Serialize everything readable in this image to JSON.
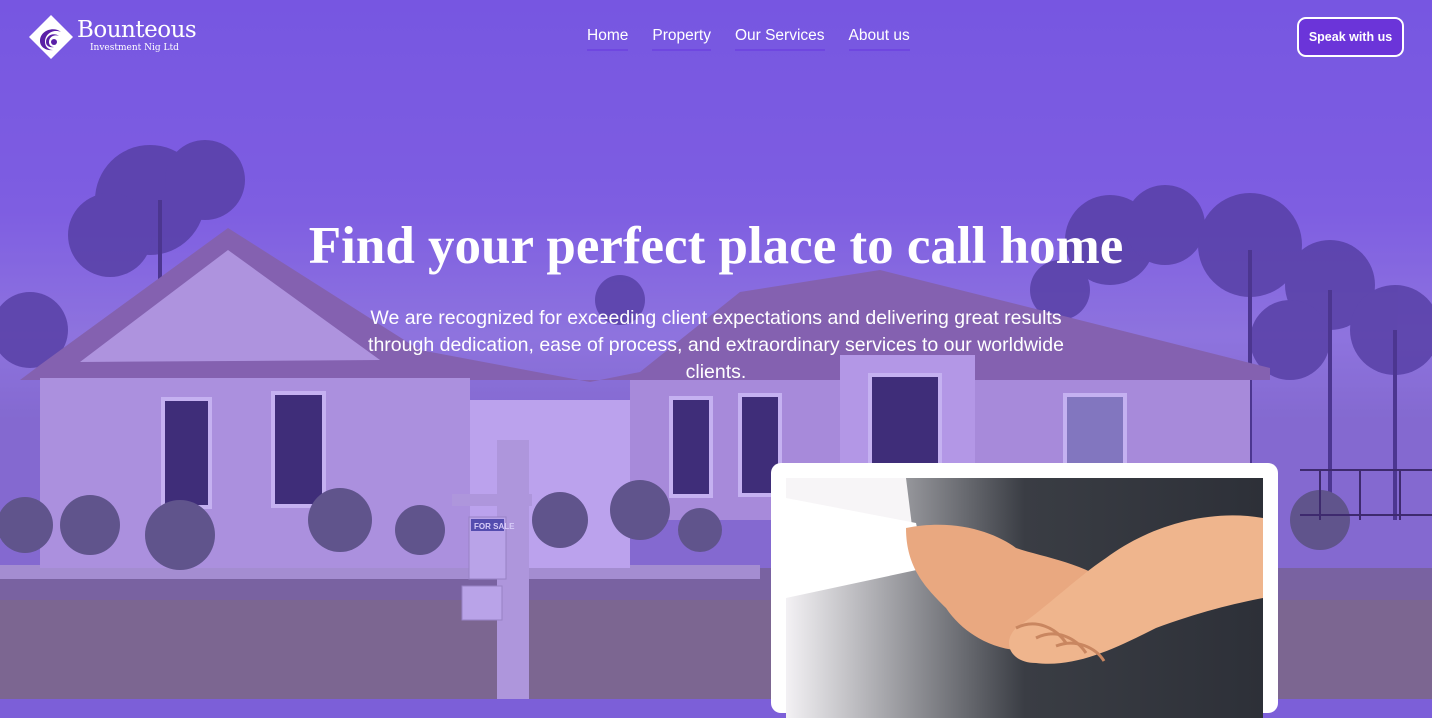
{
  "brand": {
    "name": "Bounteous",
    "sub": "Investment Nig Ltd",
    "accent": "#6b34d9",
    "overlay": "#7c5fd8"
  },
  "nav": {
    "items": [
      "Home",
      "Property",
      "Our Services",
      "About us"
    ]
  },
  "cta_label": "Speak with us",
  "hero": {
    "headline": "Find your perfect place to call home",
    "subcopy": "We are recognized for exceeding client expectations and delivering great results through dedication, ease of process, and extraordinary services to our worldwide clients.",
    "background": "house-photo",
    "sign_text": "FOR SALE"
  },
  "card": {
    "image": "handshake-photo"
  }
}
